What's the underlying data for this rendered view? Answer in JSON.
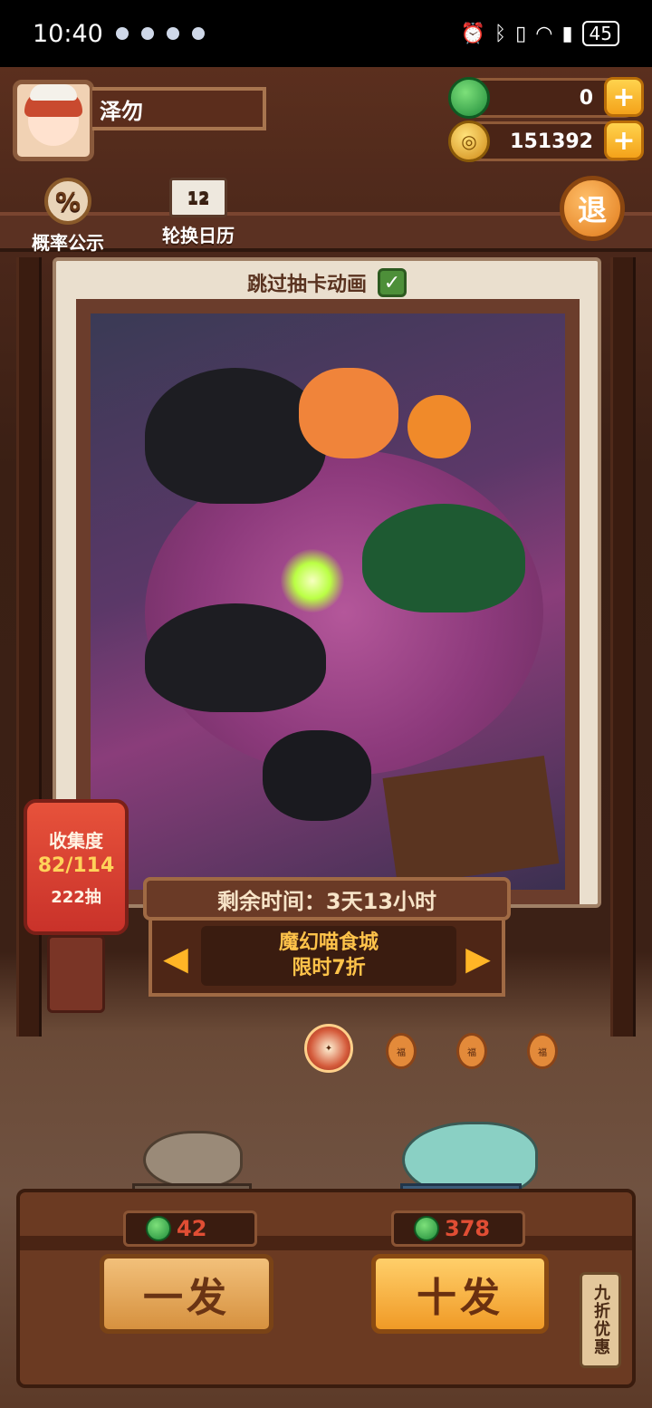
{
  "status_bar": {
    "time": "10:40",
    "battery": "45"
  },
  "player": {
    "name": "泽勿"
  },
  "currency": {
    "jade": "0",
    "gold": "151392"
  },
  "shortcuts": {
    "rate_label": "概率公示",
    "calendar_label": "轮换日历",
    "calendar_icon_text": "12",
    "rate_icon_text": "%"
  },
  "exit_label": "退",
  "card": {
    "skip_animation_label": "跳过抽卡动画",
    "skip_animation_checked": true
  },
  "collection": {
    "title": "收集度",
    "progress": "82/114",
    "draws": "222抽"
  },
  "banner": {
    "remaining_time": "剩余时间：3天13小时",
    "title_line1": "魔幻喵食城",
    "title_line2": "限时7折"
  },
  "pager": {
    "count": 4,
    "active_index": 0,
    "dot_glyph": "福"
  },
  "draw": {
    "single_label": "一发",
    "single_cost": "42",
    "ten_label": "十发",
    "ten_cost": "378",
    "discount_tag": "九折优惠"
  },
  "colors": {
    "accent": "#f09a26",
    "jade": "#1f8b3a",
    "cost_text": "#e04e34",
    "banner_text": "#ffc34a"
  }
}
